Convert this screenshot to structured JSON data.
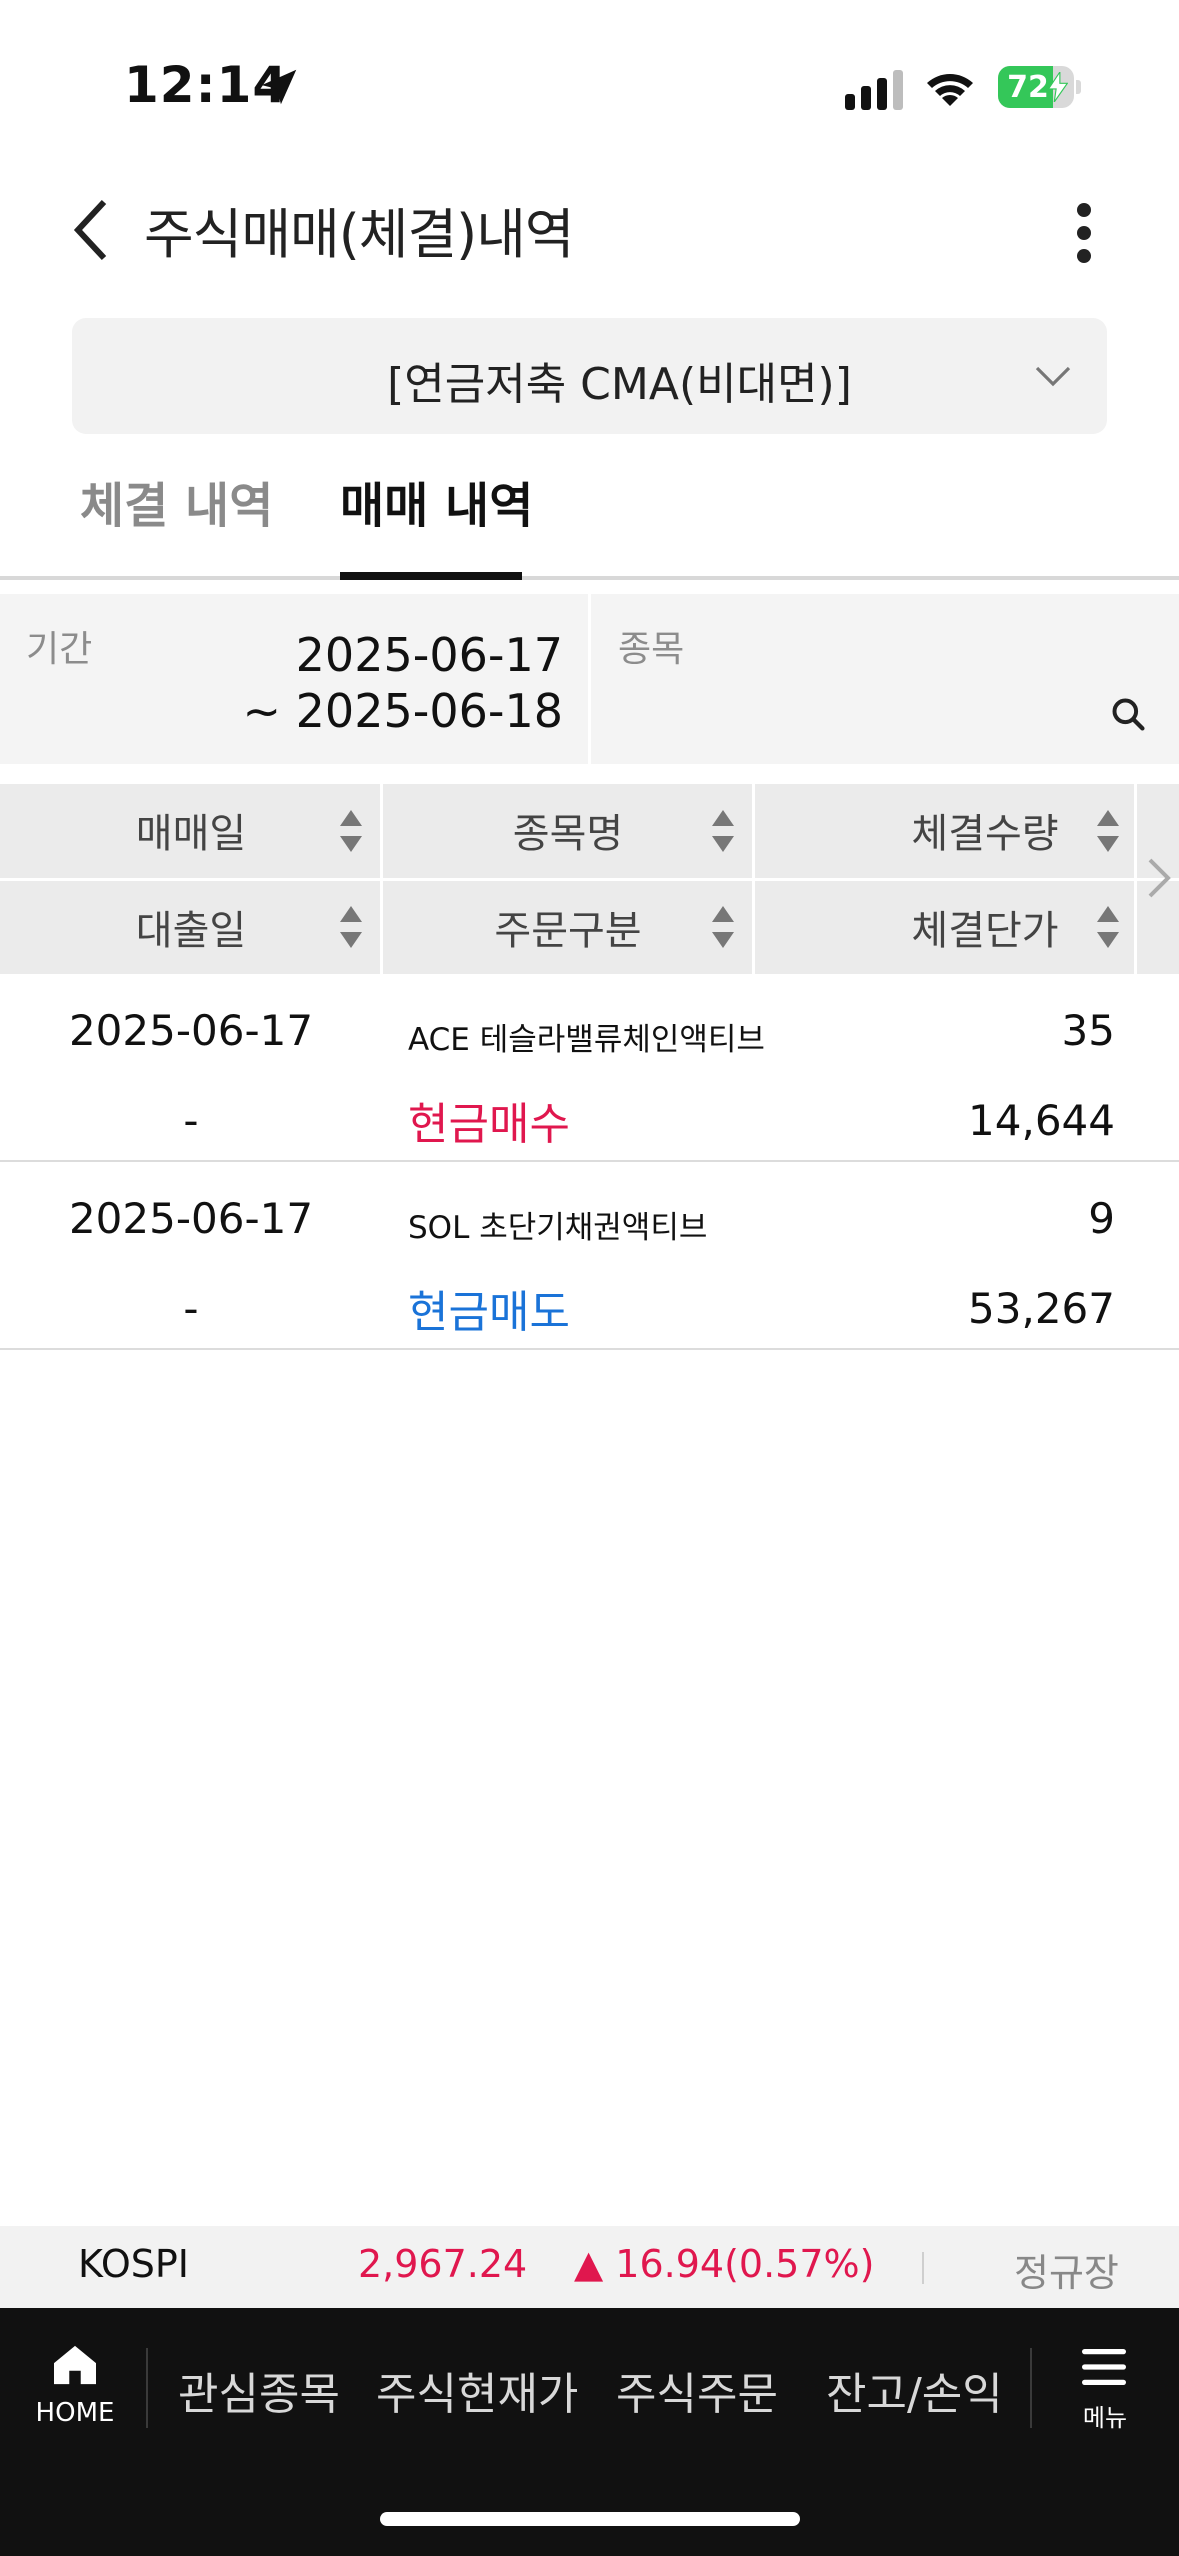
{
  "status_bar": {
    "time": "12:14",
    "battery": "72",
    "battery_level": 72
  },
  "header": {
    "title": "주식매매(체결)내역"
  },
  "account": {
    "name": "[연금저축 CMA(비대면)]"
  },
  "tabs": [
    {
      "label": "체결 내역",
      "active": false
    },
    {
      "label": "매매 내역",
      "active": true
    }
  ],
  "filter": {
    "period_label": "기간",
    "date_from": "2025-06-17",
    "date_to": "~ 2025-06-18",
    "stock_label": "종목"
  },
  "table": {
    "headers_row1": [
      "매매일",
      "종목명",
      "체결수량"
    ],
    "headers_row2": [
      "대출일",
      "주문구분",
      "체결단가"
    ],
    "rows": [
      {
        "trade_date": "2025-06-17",
        "loan_date": "-",
        "name": "ACE 테슬라밸류체인액티브",
        "order_type": "현금매수",
        "qty": "35",
        "price": "14,644"
      },
      {
        "trade_date": "2025-06-17",
        "loan_date": "-",
        "name": "SOL 초단기채권액티브",
        "order_type": "현금매도",
        "qty": "9",
        "price": "53,267"
      }
    ]
  },
  "ticker": {
    "name": "KOSPI",
    "value": "2,967.24",
    "change": "▲ 16.94(0.57%)",
    "session": "정규장"
  },
  "nav": {
    "home": "HOME",
    "items": [
      "관심종목",
      "주식현재가",
      "주식주문",
      "잔고/손익"
    ],
    "menu": "메뉴"
  },
  "colors": {
    "up": "#e0174e",
    "down": "#1a73d8",
    "battery": "#34c759"
  }
}
